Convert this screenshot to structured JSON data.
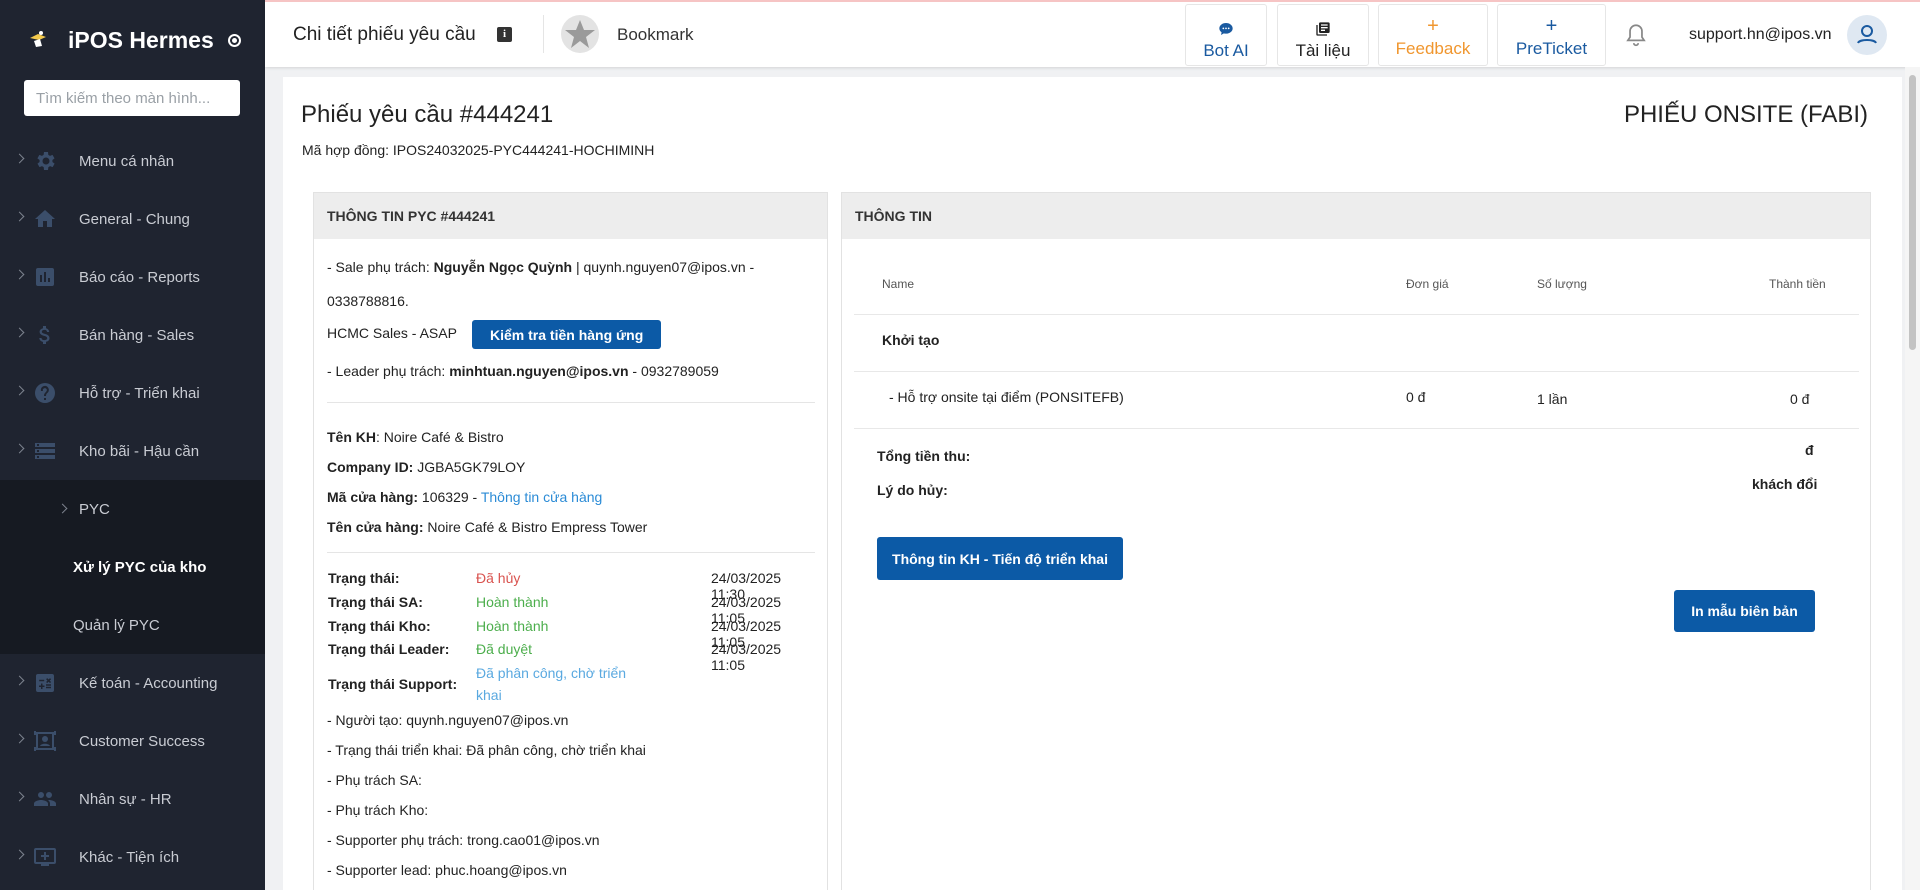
{
  "sidebar": {
    "brand": "iPOS Hermes",
    "search_placeholder": "Tìm kiếm theo màn hình...",
    "items": [
      {
        "label": "Menu cá nhân",
        "icon": "gear-icon"
      },
      {
        "label": "General - Chung",
        "icon": "home-icon"
      },
      {
        "label": "Báo cáo - Reports",
        "icon": "report-chart-icon"
      },
      {
        "label": "Bán hàng - Sales",
        "icon": "dollar-icon"
      },
      {
        "label": "Hỗ trợ - Triển khai",
        "icon": "help-circle-icon"
      },
      {
        "label": "Kho bãi - Hậu cần",
        "icon": "storage-list-icon"
      }
    ],
    "subitems": [
      {
        "label": "PYC"
      },
      {
        "label": "Xử lý PYC của kho"
      },
      {
        "label": "Quản lý PYC"
      }
    ],
    "items_after": [
      {
        "label": "Kế toán - Accounting",
        "icon": "accounting-icon"
      },
      {
        "label": "Customer Success",
        "icon": "customer-success-icon"
      },
      {
        "label": "Nhân sự - HR",
        "icon": "people-icon"
      },
      {
        "label": "Khác - Tiện ích",
        "icon": "monitor-plus-icon"
      }
    ]
  },
  "header": {
    "title": "Chi tiết phiếu yêu cầu",
    "bookmark": "Bookmark",
    "buttons": {
      "bot_ai": "Bot AI",
      "docs": "Tài liệu",
      "feedback": "Feedback",
      "preticket": "PreTicket"
    },
    "user_email": "support.hn@ipos.vn",
    "colors": {
      "feedback": "#f0962e",
      "bot": "#1a5aa0",
      "preticket": "#1a5aa0"
    }
  },
  "ticket": {
    "title": "Phiếu yêu cầu #444241",
    "contract_label": "Mã hợp đồng: ",
    "contract_value": "IPOS24032025-PYC444241-HOCHIMINH",
    "type": "PHIẾU ONSITE (FABI)"
  },
  "left_card": {
    "heading": "THÔNG TIN PYC #444241",
    "sale_prefix": "- Sale phụ trách: ",
    "sale_name": "Nguyễn Ngọc Quỳnh",
    "sale_contact": " | quynh.nguyen07@ipos.vn -",
    "sale_phone": "0338788816.",
    "sale_team": "HCMC Sales - ASAP",
    "check_button": "Kiểm tra tiền hàng ứng",
    "leader_prefix": "- Leader phụ trách: ",
    "leader_email": "minhtuan.nguyen@ipos.vn",
    "leader_phone": " - 0932789059",
    "customer": {
      "label": "Tên KH",
      "value": ": Noire Café & Bistro"
    },
    "company": {
      "label": "Company ID:",
      "value": " JGBA5GK79LOY"
    },
    "store_code": {
      "label": "Mã cửa hàng:",
      "value": " 106329 - ",
      "link": "Thông tin cửa hàng"
    },
    "store_name": {
      "label": "Tên cửa hàng:",
      "value": " Noire Café & Bistro Empress Tower"
    },
    "statuses": [
      {
        "label": "Trạng thái:",
        "value": "Đã hủy",
        "time": "24/03/2025 11:30"
      },
      {
        "label": "Trạng thái SA:",
        "value": "Hoàn thành",
        "time": "24/03/2025 11:05"
      },
      {
        "label": "Trạng thái Kho:",
        "value": "Hoàn thành",
        "time": "24/03/2025 11:05"
      },
      {
        "label": "Trạng thái Leader:",
        "value": "Đã duyệt",
        "time": "24/03/2025 11:05"
      }
    ],
    "support_status": {
      "label": "Trạng thái Support:",
      "value_line1": "Đã phân công, chờ triển",
      "value_line2": "khai"
    },
    "details": [
      "- Người tạo: quynh.nguyen07@ipos.vn",
      "- Trạng thái triển khai: Đã phân công, chờ triển khai",
      "- Phụ trách SA:",
      "- Phụ trách Kho:",
      "- Supporter phụ trách: trong.cao01@ipos.vn",
      "- Supporter lead: phuc.hoang@ipos.vn"
    ],
    "status_colors": {
      "cancelled": "#d9534f",
      "done": "#4cae4c",
      "assigned": "#5aa9e0"
    }
  },
  "right_card": {
    "heading": "THÔNG TIN",
    "columns": {
      "name": "Name",
      "price": "Đơn giá",
      "qty": "Số lượng",
      "total": "Thành tiền"
    },
    "group": "Khởi tạo",
    "row": {
      "name": "- Hỗ trợ onsite tại điểm (PONSITEFB)",
      "price": "0 đ",
      "qty": "1 lần",
      "total": "0 đ"
    },
    "total_label": "Tổng tiền thu:",
    "total_value": "đ",
    "cancel_label": "Lý do hủy:",
    "cancel_value": "khách đổi",
    "customer_progress_button": "Thông tin KH - Tiến độ triển khai",
    "print_button": "In mẫu biên bản"
  }
}
